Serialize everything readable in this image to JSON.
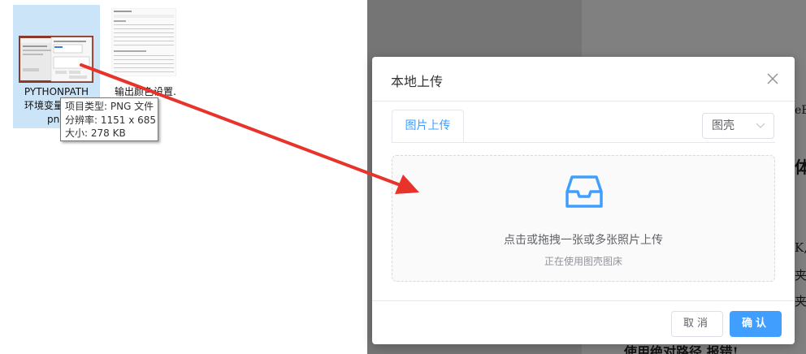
{
  "explorer": {
    "files": [
      {
        "label_line1": "PYTHONPATH",
        "label_line2": "环境变量",
        "label_line3": "png"
      },
      {
        "label_line1": "输出颜色设置."
      }
    ],
    "tooltip": {
      "type": "项目类型: PNG 文件",
      "resolution": "分辨率: 1151 x 685",
      "size": "大小: 278 KB"
    }
  },
  "background": {
    "frag_right_top": "eE",
    "frag_right_big": "体",
    "frag_right_mid1": "K,",
    "frag_right_mid2": "夹中",
    "frag_right_mid3": "夹中",
    "frag_bottom": "使用绝对路径 报错!"
  },
  "modal": {
    "title": "本地上传",
    "tab_label": "图片上传",
    "host_value": "图壳",
    "drop_text": "点击或拖拽一张或多张照片上传",
    "drop_subtext": "正在使用图壳图床",
    "cancel_label": "取消",
    "confirm_label": "确认"
  },
  "colors": {
    "accent": "#409eff",
    "arrow": "#e8332a",
    "overlay": "#7a7a7a"
  }
}
